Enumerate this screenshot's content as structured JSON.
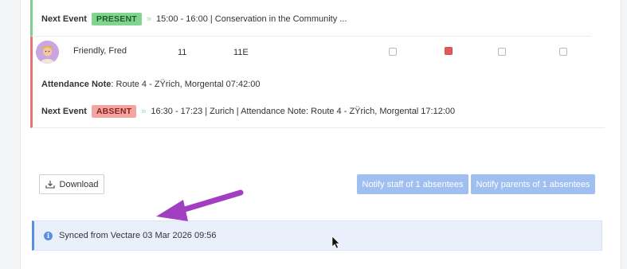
{
  "present_row": {
    "next_event_label": "Next Event",
    "status_badge": "PRESENT",
    "event_text": "15:00 - 16:00 | Conservation in the Community ..."
  },
  "student_row": {
    "name": "Friendly, Fred",
    "year": "11",
    "form": "11E",
    "checkboxes": [
      {
        "checked": false
      },
      {
        "checked": true
      },
      {
        "checked": false
      },
      {
        "checked": false
      }
    ],
    "attendance_note_label": "Attendance Note",
    "attendance_note_value": ": Route 4 - ZŸrich, Morgental 07:42:00",
    "next_event_label": "Next Event",
    "status_badge": "ABSENT",
    "event_text": "16:30 - 17:23 | Zurich | Attendance Note: Route 4 - ZŸrich, Morgental 17:12:00"
  },
  "actions": {
    "download_label": "Download",
    "notify_staff_label": "Notify staff of 1 absentees",
    "notify_parents_label": "Notify parents of 1 absentees"
  },
  "sync_notice": {
    "text": "Synced from Vectare 03 Mar 2026 09:56"
  },
  "colors": {
    "present": "#7fd48e",
    "absent": "#f3a5a2",
    "notify_button": "#9fbff0",
    "info": "#5b8fe0",
    "annotation_arrow": "#a13fc0"
  },
  "icons": {
    "arrow": "double-chevron-right-icon",
    "download": "download-tray-icon",
    "info": "info-circle-icon"
  }
}
